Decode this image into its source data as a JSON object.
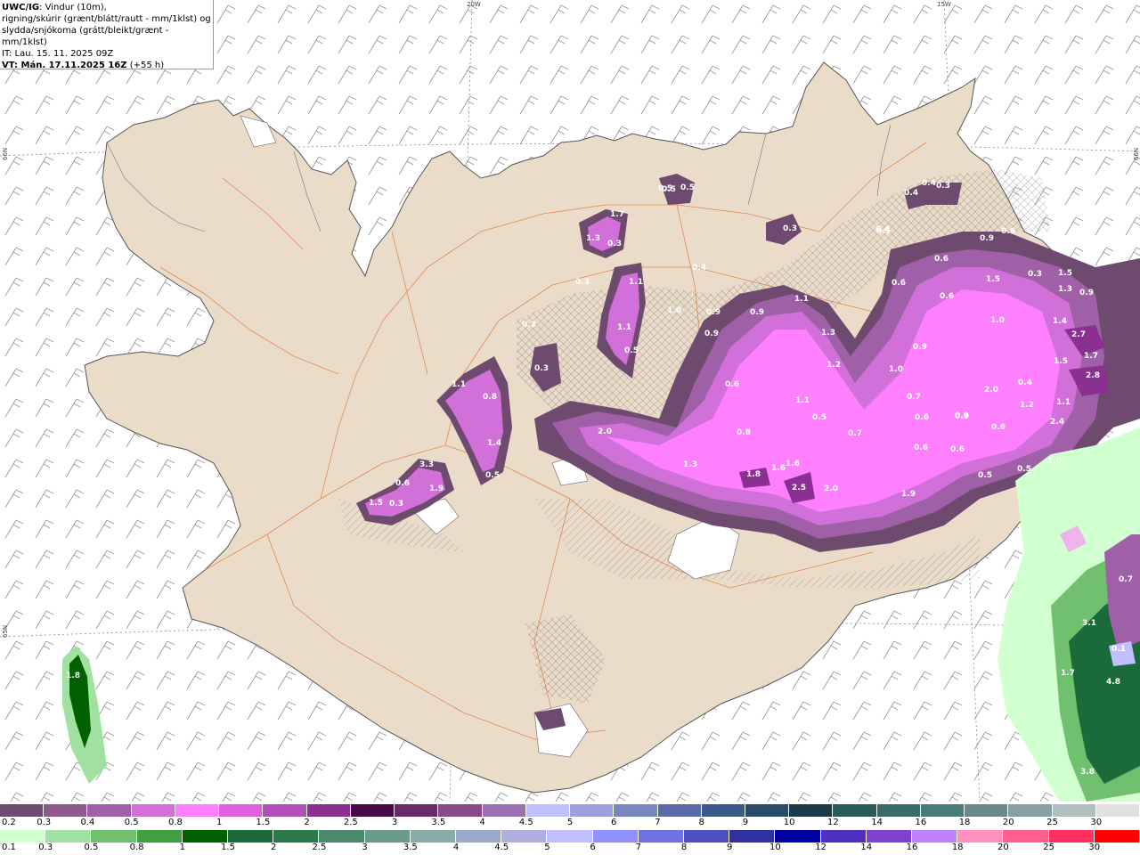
{
  "header": {
    "model": "UWC/IG",
    "line1_rest": ": Vindur (10m),",
    "line2": "rigning/skúrir (grænt/blátt/rautt - mm/1klst) og",
    "line3": "slydda/snjókoma (grátt/bleikt/grænt - mm/1klst)",
    "init_time": "IT: Lau. 15. 11. 2025 09Z",
    "valid_prefix": "VT: Mán. 17.11.2025 16Z",
    "valid_suffix": " (+55 h)"
  },
  "grid_labels": {
    "lon_20w": "20W",
    "lon_15w": "15W",
    "lat_66n_left": "66N",
    "lat_66n_right": "66N",
    "lat_65n": "65N"
  },
  "precip_labels": [
    "0.5",
    "0.5",
    "0.4",
    "0.3",
    "1.7",
    "1.3",
    "0.3",
    "0.3",
    "0.3",
    "0.3",
    "0.9",
    "0.6",
    "1.1",
    "0.4",
    "0.4",
    "0.6",
    "0.6",
    "1.0",
    "0.9",
    "0.9",
    "1.1",
    "0.9",
    "1.3",
    "0.6",
    "0.3",
    "1.5",
    "1.5",
    "0.9",
    "1.0",
    "1.3",
    "1.4",
    "2.7",
    "1.7",
    "1.5",
    "2.8",
    "0.3",
    "1.1",
    "0.5",
    "0.9",
    "1.0",
    "1.2",
    "0.6",
    "0.7",
    "0.9",
    "2.0",
    "0.4",
    "1.2",
    "1.1",
    "1.1",
    "0.5",
    "0.7",
    "0.6",
    "0.9",
    "0.6",
    "0.6",
    "0.6",
    "0.5",
    "0.5",
    "2.4",
    "1.0",
    "2.0",
    "1.3",
    "1.8",
    "1.6",
    "1.6",
    "2.5",
    "2.0",
    "1.9",
    "0.4",
    "1.1",
    "0.8",
    "1.4",
    "0.5",
    "3.3",
    "0.6",
    "1.9",
    "1.5",
    "0.3",
    "0.8",
    "1.8",
    "0.7",
    "3.1",
    "0.1",
    "1.7",
    "4.8",
    "3.8",
    "0.5",
    "0.5"
  ],
  "colorbar_snow": {
    "labels": [
      "0.2",
      "0.3",
      "0.4",
      "0.5",
      "0.8",
      "1",
      "1.5",
      "2",
      "2.5",
      "3",
      "3.5",
      "4",
      "4.5",
      "5",
      "6",
      "7",
      "8",
      "9",
      "10",
      "12",
      "14",
      "16",
      "18",
      "20",
      "25",
      "30"
    ],
    "colors": [
      "#6e4a6e",
      "#8e5a8e",
      "#a060a8",
      "#d070d8",
      "#ff80ff",
      "#e060e0",
      "#b050b8",
      "#8a3090",
      "#4a0a4a",
      "#6a2a6a",
      "#8a4a8a",
      "#9a70b0",
      "#c0c0ff",
      "#a0a0e0",
      "#7a86c0",
      "#5a6aa8",
      "#3a5a8a",
      "#2a4a6a",
      "#1a3a4a",
      "#2a5a5a",
      "#3a6a6a",
      "#4a7a7a",
      "#6a8a8a",
      "#8aa0a0",
      "#b0c0c0",
      "#e0e0e0"
    ]
  },
  "colorbar_rain": {
    "labels": [
      "0.1",
      "0.3",
      "0.5",
      "0.8",
      "1",
      "1.5",
      "2",
      "2.5",
      "3",
      "3.5",
      "4",
      "4.5",
      "5",
      "6",
      "7",
      "8",
      "9",
      "10",
      "12",
      "14",
      "16",
      "18",
      "20",
      "25",
      "30"
    ],
    "colors": [
      "#d0ffd0",
      "#a0e0a0",
      "#70c070",
      "#40a040",
      "#006000",
      "#1a6a3a",
      "#2a7a4a",
      "#4a8a6a",
      "#6a9a8a",
      "#8aaaaa",
      "#9aaacc",
      "#b0b0e0",
      "#c0c0ff",
      "#9090ff",
      "#7070e0",
      "#5050c0",
      "#3030a0",
      "#0000a0",
      "#5030c0",
      "#8040d0",
      "#c080ff",
      "#ff90c0",
      "#ff6090",
      "#ff3060",
      "#ff0000"
    ]
  }
}
